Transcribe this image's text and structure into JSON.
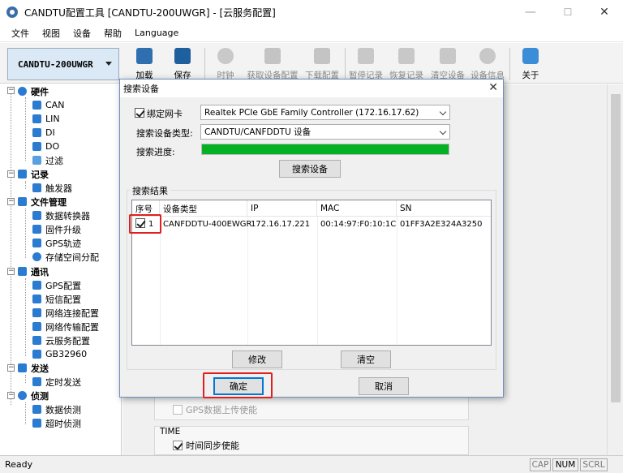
{
  "window": {
    "title": "CANDTU配置工具 [CANDTU-200UWGR] - [云服务配置]",
    "minimize": "—",
    "maximize": "☐",
    "close": "✕"
  },
  "menu": [
    "文件",
    "视图",
    "设备",
    "帮助",
    "Language"
  ],
  "toolbar": {
    "device": "CANDTU-200UWGR",
    "buttons": [
      {
        "label": "加载",
        "icon": "load-icon",
        "enabled": true
      },
      {
        "label": "保存",
        "icon": "save-icon",
        "enabled": true
      },
      {
        "label": "时钟",
        "icon": "clock-icon",
        "enabled": false
      },
      {
        "label": "获取设备配置",
        "icon": "get-config-icon",
        "enabled": false
      },
      {
        "label": "下载配置",
        "icon": "download-config-icon",
        "enabled": false
      },
      {
        "label": "暂停记录",
        "icon": "pause-icon",
        "enabled": false
      },
      {
        "label": "恢复记录",
        "icon": "resume-icon",
        "enabled": false
      },
      {
        "label": "清空设备",
        "icon": "clear-device-icon",
        "enabled": false
      },
      {
        "label": "设备信息",
        "icon": "info-icon",
        "enabled": false
      },
      {
        "label": "关于",
        "icon": "about-icon",
        "enabled": true
      }
    ]
  },
  "tree": {
    "groups": [
      {
        "label": "硬件",
        "items": [
          "CAN",
          "LIN",
          "DI",
          "DO",
          "过滤"
        ]
      },
      {
        "label": "记录",
        "items": [
          "触发器"
        ]
      },
      {
        "label": "文件管理",
        "items": [
          "数据转换器",
          "固件升级",
          "GPS轨迹",
          "存储空间分配"
        ]
      },
      {
        "label": "通讯",
        "items": [
          "GPS配置",
          "短信配置",
          "网络连接配置",
          "网络传输配置",
          "云服务配置",
          "GB32960"
        ]
      },
      {
        "label": "发送",
        "items": [
          "定时发送"
        ]
      },
      {
        "label": "侦测",
        "items": [
          "数据侦测",
          "超时侦测"
        ]
      }
    ]
  },
  "background_form": {
    "gps_upload_label": "GPS数据上传使能",
    "time_group_label": "TIME",
    "time_sync_label": "时间同步使能"
  },
  "dialog": {
    "title": "搜索设备",
    "close": "✕",
    "bind_nic_label": "绑定网卡",
    "bind_nic_checked": true,
    "nic_value": "Realtek PCIe GbE Family Controller (172.16.17.62)",
    "device_type_label": "搜索设备类型:",
    "device_type_value": "CANDTU/CANFDDTU 设备",
    "progress_label": "搜索进度:",
    "progress_fraction": 1.0,
    "search_button": "搜索设备",
    "results_group": "搜索结果",
    "columns": [
      "序号",
      "设备类型",
      "IP",
      "MAC",
      "SN"
    ],
    "rows": [
      {
        "checked": true,
        "index": "1",
        "type": "CANFDDTU-400EWGR",
        "ip": "172.16.17.221",
        "mac": "00:14:97:F0:10:1C",
        "sn": "01FF3A2E324A3250"
      }
    ],
    "modify_button": "修改",
    "clear_button": "清空",
    "ok_button": "确定",
    "cancel_button": "取消"
  },
  "status": {
    "text": "Ready",
    "indicators": [
      "CAP",
      "NUM",
      "SCRL"
    ]
  },
  "colors": {
    "progress_fill": "#06b025",
    "highlight": "#e0201e",
    "device_select_bg": "#dbe9f6"
  }
}
